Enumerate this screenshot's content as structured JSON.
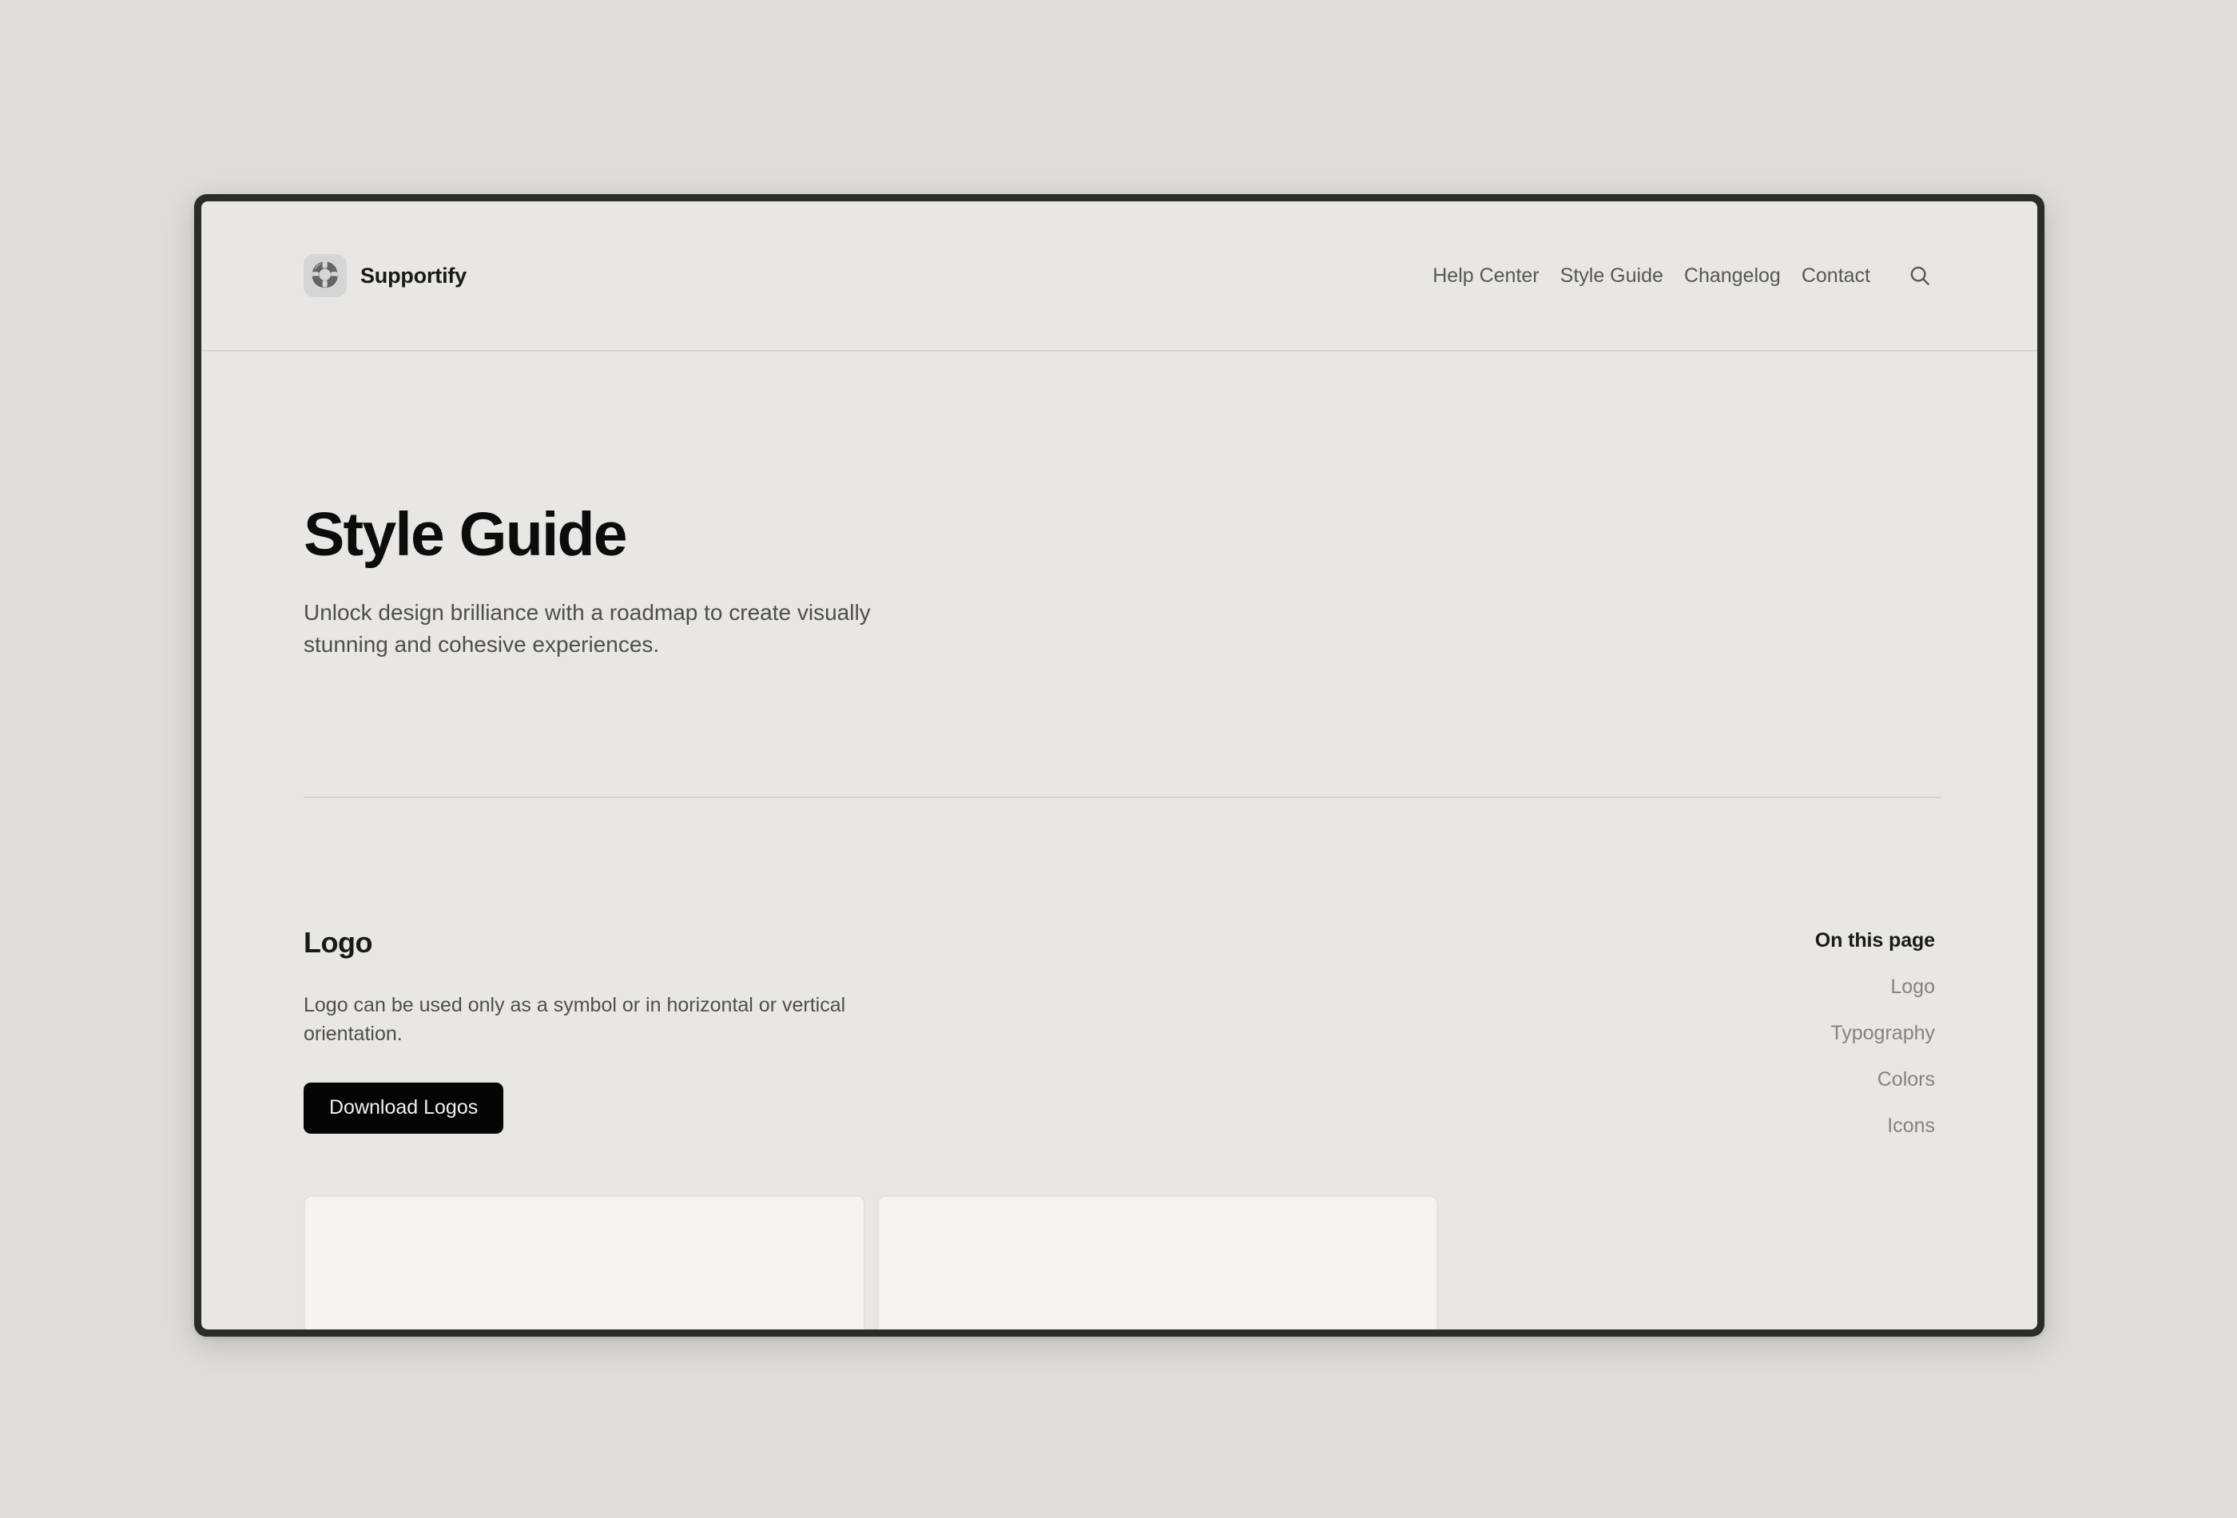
{
  "header": {
    "brand": {
      "name": "Supportify",
      "logo_icon": "lifebuoy-icon",
      "logo_glyph": "🛟"
    },
    "nav": [
      {
        "label": "Help Center"
      },
      {
        "label": "Style Guide"
      },
      {
        "label": "Changelog"
      },
      {
        "label": "Contact"
      }
    ],
    "search": {
      "icon": "search-icon",
      "aria": "Search"
    }
  },
  "hero": {
    "title": "Style Guide",
    "subtitle": "Unlock design brilliance with a roadmap to create visually stunning and cohesive experiences."
  },
  "logo_section": {
    "heading": "Logo",
    "description": "Logo can be used only as a symbol or in horizontal or vertical orientation.",
    "download_button": "Download Logos"
  },
  "toc": {
    "title": "On this page",
    "items": [
      {
        "label": "Logo"
      },
      {
        "label": "Typography"
      },
      {
        "label": "Colors"
      },
      {
        "label": "Icons"
      }
    ]
  },
  "colors": {
    "page_background": "#e8e7e3",
    "desktop_background": "#dedddb",
    "window_frame": "#2b2b29",
    "card_background": "#f5f4f2",
    "card_border": "#e3e2de",
    "text_primary": "#19191a",
    "text_muted": "#4e4e4d",
    "text_faint": "#84837f",
    "button_background": "#050505",
    "button_text": "#f2f1ef",
    "rule": "#d4d3cf"
  }
}
